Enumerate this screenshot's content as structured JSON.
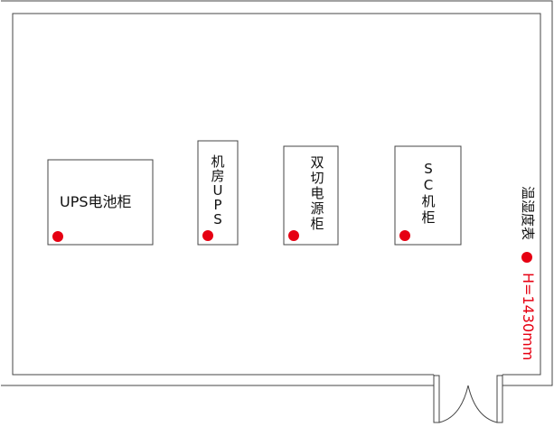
{
  "equipment": {
    "ups_battery_cabinet": {
      "label": "UPS电池柜"
    },
    "room_ups": {
      "chars": [
        "机",
        "房",
        "U",
        "P",
        "S"
      ]
    },
    "dual_power_cabinet": {
      "chars": [
        "双",
        "切",
        "电",
        "源",
        "柜"
      ]
    },
    "sc_cabinet": {
      "chars": [
        "S",
        "C",
        "机",
        "柜"
      ]
    }
  },
  "sensor": {
    "label": "温湿度表",
    "height_label": "H=1430mm"
  },
  "colors": {
    "wall": "#444444",
    "marker": "#e60012",
    "height_text": "#e60012"
  }
}
